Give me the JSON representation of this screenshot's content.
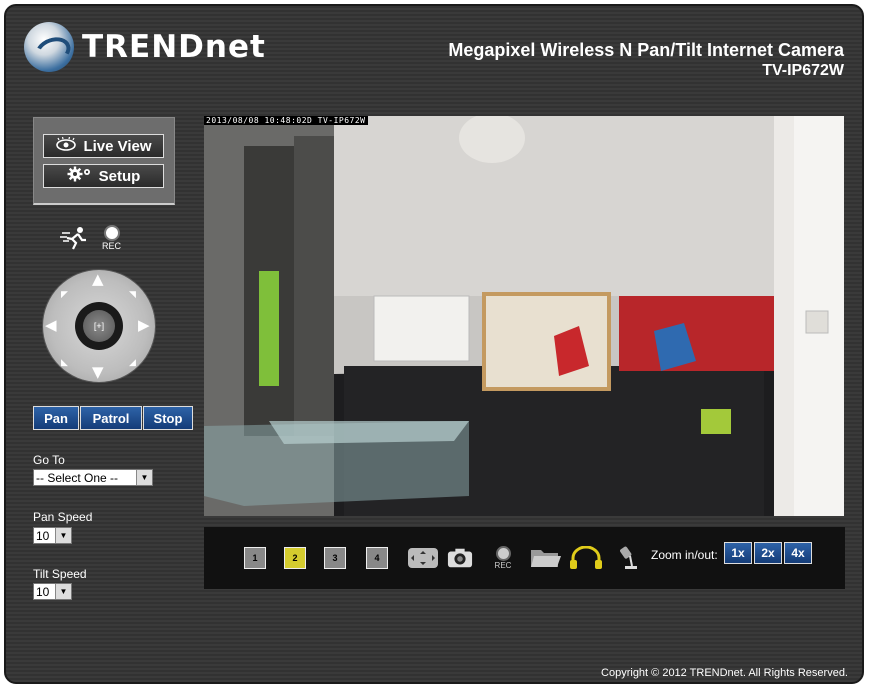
{
  "header": {
    "brand": "TRENDnet",
    "product_title": "Megapixel Wireless N Pan/Tilt Internet Camera",
    "model": "TV-IP672W"
  },
  "menu": {
    "live_view_label": "Live View",
    "setup_label": "Setup"
  },
  "record": {
    "rec_label": "REC"
  },
  "ptz": {
    "home_label": "[+]"
  },
  "ptz_buttons": {
    "pan_label": "Pan",
    "patrol_label": "Patrol",
    "stop_label": "Stop"
  },
  "goto": {
    "label": "Go To",
    "selected": "-- Select One --"
  },
  "pan_speed": {
    "label": "Pan Speed",
    "selected": "10"
  },
  "tilt_speed": {
    "label": "Tilt Speed",
    "selected": "10"
  },
  "video": {
    "timestamp": "2013/08/08 10:48:02D TV-IP672W"
  },
  "toolbar": {
    "cameras": [
      "1",
      "2",
      "3",
      "4"
    ],
    "active_camera": "2",
    "rec_label": "REC",
    "zoom_label": "Zoom in/out:",
    "zoom_options": [
      "1x",
      "2x",
      "4x"
    ]
  },
  "footer": {
    "copyright": "Copyright © 2012 TRENDnet. All Rights Reserved."
  }
}
